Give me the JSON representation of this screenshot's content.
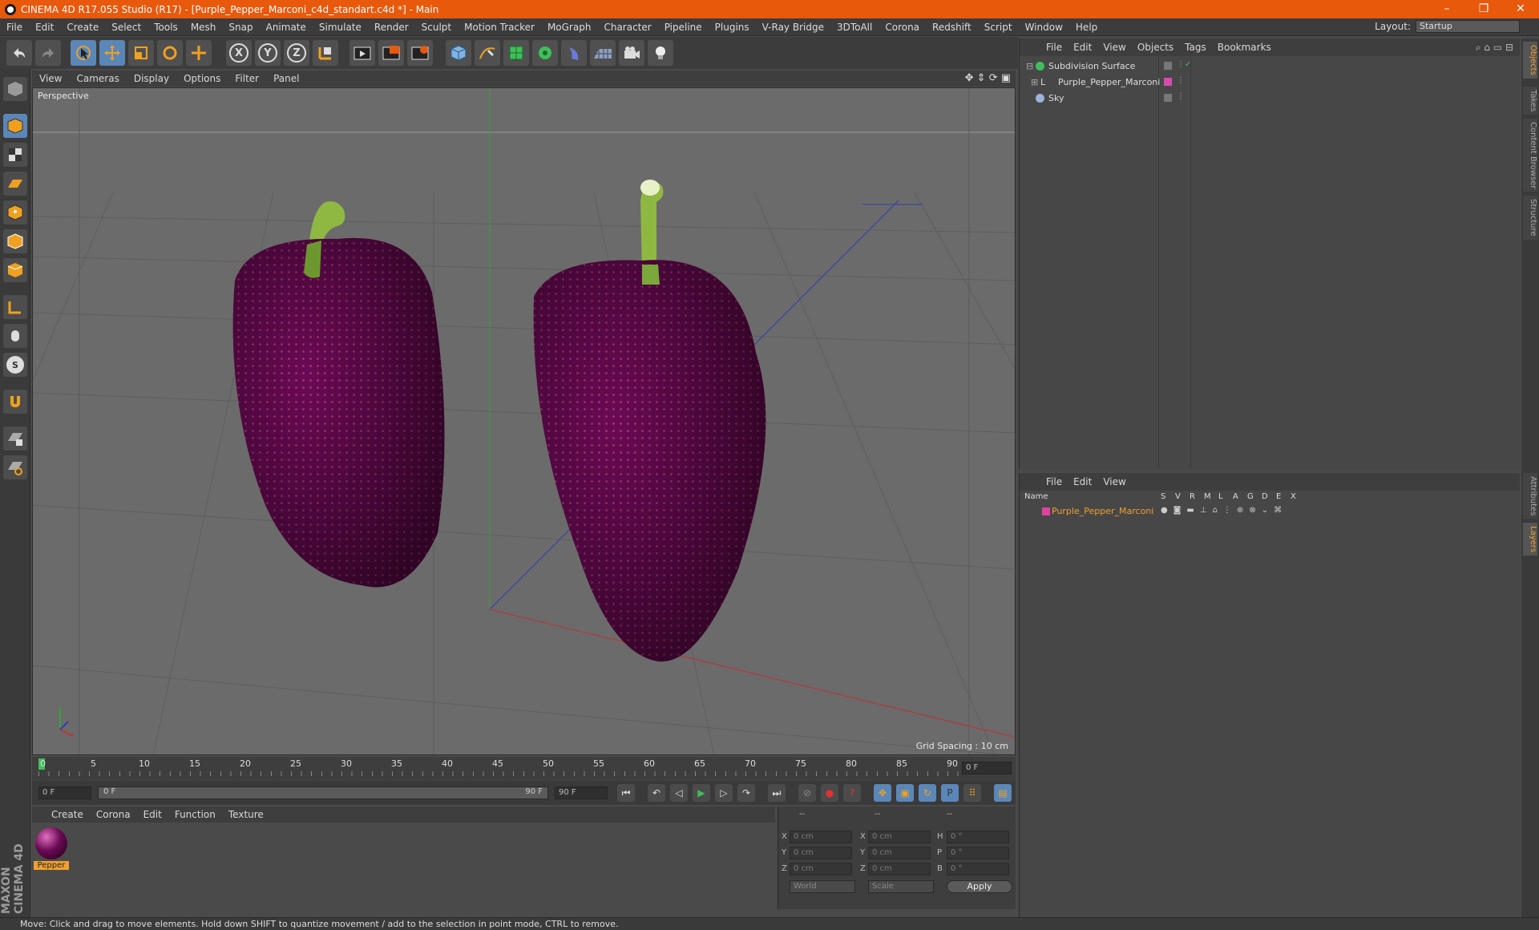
{
  "window": {
    "title": "CINEMA 4D R17.055 Studio (R17) - [Purple_Pepper_Marconi_c4d_standart.c4d *] - Main",
    "minimize": "–",
    "maximize": "❐",
    "close": "✕"
  },
  "menubar": {
    "items": [
      "File",
      "Edit",
      "Create",
      "Select",
      "Tools",
      "Mesh",
      "Snap",
      "Animate",
      "Simulate",
      "Render",
      "Sculpt",
      "Motion Tracker",
      "MoGraph",
      "Character",
      "Pipeline",
      "Plugins",
      "V-Ray Bridge",
      "3DToAll",
      "Corona",
      "Redshift",
      "Script",
      "Window",
      "Help"
    ],
    "layout_label": "Layout:",
    "layout_value": "Startup"
  },
  "toolbar": {
    "icons": [
      "undo-icon",
      "redo-icon",
      "select-arrow-icon",
      "move-icon",
      "scale-icon",
      "rotate-icon",
      "transform-icon",
      "x-axis-icon",
      "y-axis-icon",
      "z-axis-icon",
      "coordinate-system-icon",
      "render-view-icon",
      "render-picture-viewer-icon",
      "edit-render-settings-icon",
      "cube-icon",
      "pen-spline-icon",
      "subdivision-icon",
      "array-icon",
      "deformer-icon",
      "floor-icon",
      "camera-icon",
      "light-icon"
    ],
    "axis_labels": [
      "X",
      "Y",
      "Z"
    ]
  },
  "viewport": {
    "menu": [
      "View",
      "Cameras",
      "Display",
      "Options",
      "Filter",
      "Panel"
    ],
    "label": "Perspective",
    "grid_spacing": "Grid Spacing : 10 cm"
  },
  "timeline": {
    "ticks": [
      "0",
      "5",
      "10",
      "15",
      "20",
      "25",
      "30",
      "35",
      "40",
      "45",
      "50",
      "55",
      "60",
      "65",
      "70",
      "75",
      "80",
      "85",
      "90"
    ],
    "current_frame": "0 F",
    "start_field": "0 F",
    "range_start": "0 F",
    "range_end": "90 F",
    "end_field": "90 F"
  },
  "materials": {
    "menu": [
      "Create",
      "Corona",
      "Edit",
      "Function",
      "Texture"
    ],
    "items": [
      {
        "name": "Pepper",
        "color": "#6a0a55"
      }
    ]
  },
  "coordinates": {
    "header": [
      "--",
      "--",
      "--"
    ],
    "rows": [
      {
        "axis": "X",
        "pos": "0 cm",
        "axis2": "X",
        "size": "0 cm",
        "rot_axis": "H",
        "rot": "0 °"
      },
      {
        "axis": "Y",
        "pos": "0 cm",
        "axis2": "Y",
        "size": "0 cm",
        "rot_axis": "P",
        "rot": "0 °"
      },
      {
        "axis": "Z",
        "pos": "0 cm",
        "axis2": "Z",
        "size": "0 cm",
        "rot_axis": "B",
        "rot": "0 °"
      }
    ],
    "mode_world": "World",
    "mode_scale": "Scale",
    "apply": "Apply"
  },
  "objects_panel": {
    "menu": [
      "File",
      "Edit",
      "View",
      "Objects",
      "Tags",
      "Bookmarks"
    ],
    "rows": [
      {
        "name": "Subdivision Surface",
        "color": "#3fbf5a"
      },
      {
        "name": "Purple_Pepper_Marconi",
        "color": "#d64bb0"
      },
      {
        "name": "Sky",
        "color": "#9ab4d8"
      }
    ]
  },
  "layers_panel": {
    "menu": [
      "File",
      "Edit",
      "View"
    ],
    "columns": [
      "Name",
      "S",
      "V",
      "R",
      "M",
      "L",
      "A",
      "G",
      "D",
      "E",
      "X"
    ],
    "rows": [
      {
        "name": "Purple_Pepper_Marconi",
        "color": "#e040a0"
      }
    ]
  },
  "right_tabs": [
    "Objects",
    "Takes",
    "Content Browser",
    "Structure",
    "Attributes",
    "Layers"
  ],
  "brand": "MAXON CINEMA 4D",
  "status": "Move: Click and drag to move elements. Hold down SHIFT to quantize movement / add to the selection in point mode, CTRL to remove.",
  "colors": {
    "title_bar": "#e8590c",
    "accent": "#5b87b8",
    "pepper": "#6a0a55",
    "stem": "#7ea83a",
    "highlight_text": "#f0a030"
  }
}
